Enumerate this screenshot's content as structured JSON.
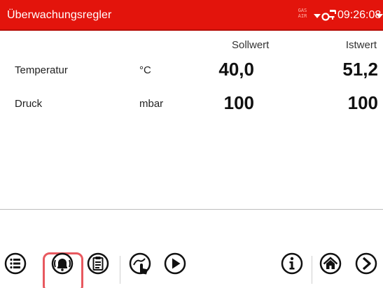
{
  "header": {
    "title": "Überwachungsregler",
    "gas_label": "GAS",
    "air_label": "AIR",
    "time": "09:26:08"
  },
  "columns": {
    "setpoint": "Sollwert",
    "actual": "Istwert"
  },
  "rows": [
    {
      "label": "Temperatur",
      "unit": "°C",
      "setpoint": "40,0",
      "actual": "51,2"
    },
    {
      "label": "Druck",
      "unit": "mbar",
      "setpoint": "100",
      "actual": "100"
    }
  ],
  "toolbar": {
    "icons": [
      "menu-icon",
      "alarm-icon",
      "clipboard-icon",
      "touch-icon",
      "play-icon",
      "info-icon",
      "home-icon",
      "next-icon"
    ],
    "highlighted": "alarm-icon"
  },
  "colors": {
    "titlebar": "#e3140c",
    "highlight": "#e8595f"
  }
}
